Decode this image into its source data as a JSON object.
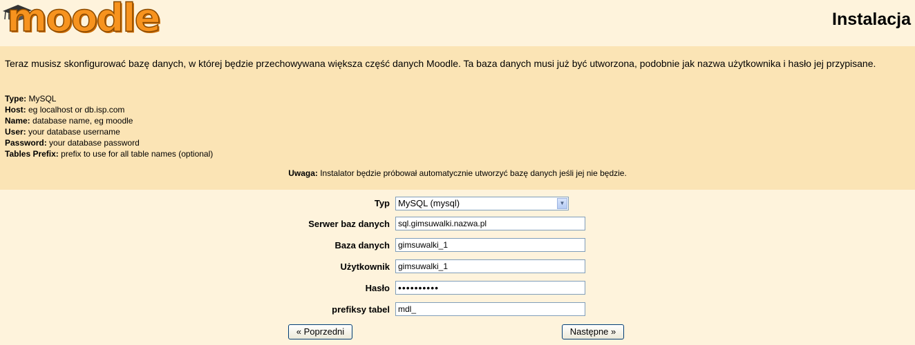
{
  "header": {
    "logo_text": "moodle",
    "page_title": "Instalacja"
  },
  "intro": {
    "description": "Teraz musisz skonfigurować bazę danych, w której będzie przechowywana większa część danych Moodle. Ta baza danych musi już być utworzona, podobnie jak nazwa użytkownika i hasło jej przypisane.",
    "fields": [
      {
        "label": "Type:",
        "value": " MySQL"
      },
      {
        "label": "Host:",
        "value": " eg localhost or db.isp.com"
      },
      {
        "label": "Name:",
        "value": " database name, eg moodle"
      },
      {
        "label": "User:",
        "value": " your database username"
      },
      {
        "label": "Password:",
        "value": " your database password"
      },
      {
        "label": "Tables Prefix:",
        "value": " prefix to use for all table names (optional)"
      }
    ],
    "note_label": "Uwaga:",
    "note_text": " Instalator będzie próbował automatycznie utworzyć bazę danych jeśli jej nie będzie."
  },
  "form": {
    "type_label": "Typ",
    "type_value": "MySQL (mysql)",
    "host_label": "Serwer baz danych",
    "host_value": "sql.gimsuwalki.nazwa.pl",
    "name_label": "Baza danych",
    "name_value": "gimsuwalki_1",
    "user_label": "Użytkownik",
    "user_value": "gimsuwalki_1",
    "pass_label": "Hasło",
    "pass_value": "••••••••••",
    "prefix_label": "prefiksy tabel",
    "prefix_value": "mdl_"
  },
  "buttons": {
    "prev_label": "« Poprzedni",
    "next_label": "Następne »"
  },
  "colors": {
    "page_bg": "#fef3dc",
    "intro_bg": "#fbe4b5",
    "logo_orange": "#f7931e"
  }
}
